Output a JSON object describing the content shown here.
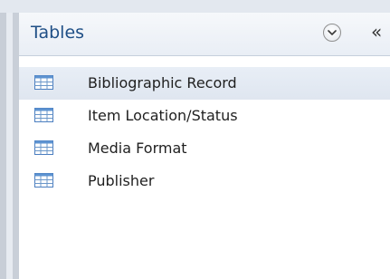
{
  "pane": {
    "title": "Tables",
    "collapse_glyph": "«",
    "dropdown_icon": "chevron-down-circle-icon",
    "items": [
      {
        "label": "Bibliographic Record",
        "icon": "table-icon",
        "selected": true
      },
      {
        "label": "Item Location/Status",
        "icon": "table-icon",
        "selected": false
      },
      {
        "label": "Media Format",
        "icon": "table-icon",
        "selected": false
      },
      {
        "label": "Publisher",
        "icon": "table-icon",
        "selected": false
      }
    ]
  }
}
